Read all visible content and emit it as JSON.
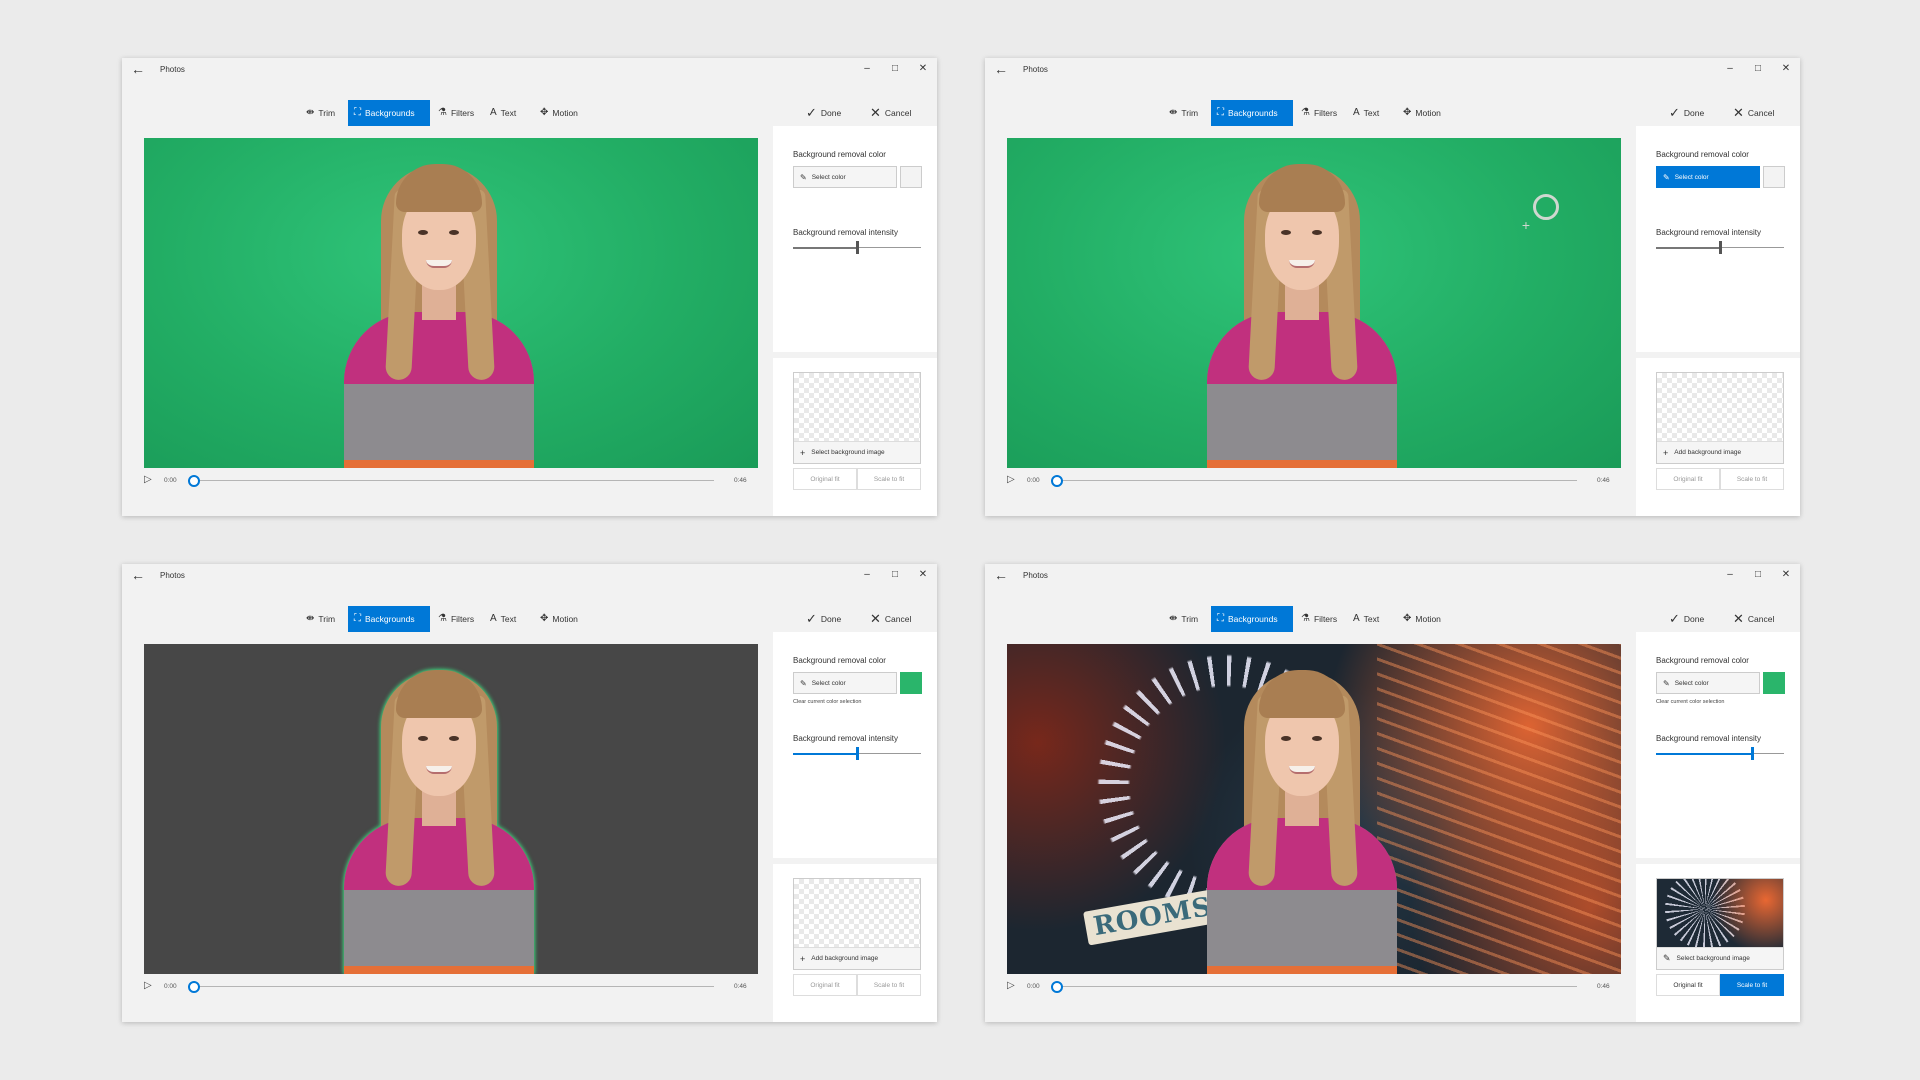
{
  "app": {
    "title": "Photos",
    "back_icon": "back-arrow-icon"
  },
  "window_controls": {
    "minimize": "–",
    "maximize": "□",
    "close": "✕"
  },
  "toolbar": {
    "trim": "Trim",
    "backgrounds": "Backgrounds",
    "filters": "Filters",
    "text": "Text",
    "motion": "Motion",
    "done": "Done",
    "cancel": "Cancel",
    "active_tab": "Backgrounds",
    "accent_color": "#0078d7"
  },
  "panel": {
    "bg_removal_color_label": "Background removal color",
    "select_color": "Select color",
    "bg_removal_intensity_label": "Background removal intensity",
    "clear_link": "Clear current color selection",
    "original_fit": "Original fit",
    "scale_to_fit": "Scale to fit",
    "picked_color": "#2ab56b"
  },
  "screens": [
    {
      "time_start": "0:00",
      "time_end": "0:46",
      "playback_progress": 0.0,
      "canvas_background": "green screen",
      "select_color_active": false,
      "intensity": 0.5,
      "image_button": "Select background image"
    },
    {
      "time_start": "0:00",
      "time_end": "0:46",
      "playback_progress": 0.0,
      "canvas_background": "green screen",
      "select_color_active": true,
      "intensity": 0.5,
      "image_button": "Add background image"
    },
    {
      "time_start": "0:00",
      "time_end": "0:46",
      "playback_progress": 0.0,
      "canvas_background": "dark gray",
      "select_color_active": false,
      "intensity": 0.5,
      "image_button": "Add background image"
    },
    {
      "time_start": "0:00",
      "time_end": "0:46",
      "playback_progress": 0.0,
      "canvas_background": "fairground at night",
      "sign_text": "ROOMS",
      "select_color_active": false,
      "intensity": 0.75,
      "image_button": "Select background image",
      "fit_selected": "Scale to fit"
    }
  ]
}
